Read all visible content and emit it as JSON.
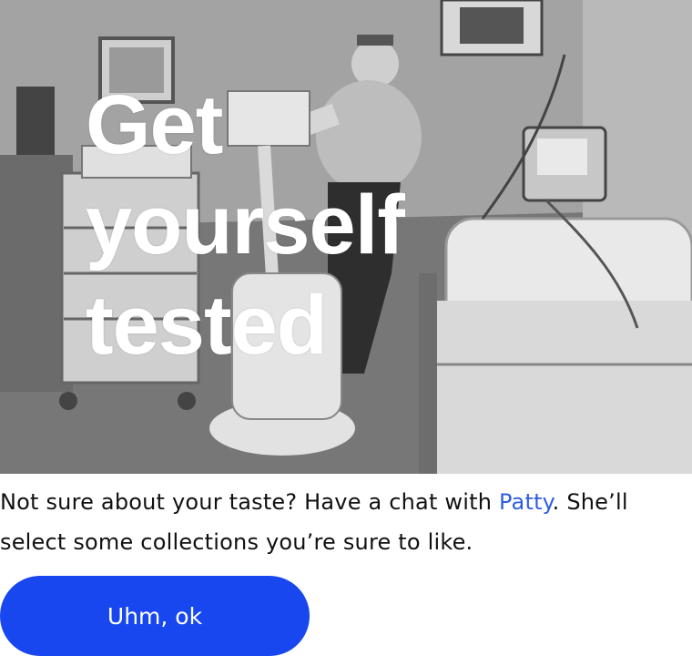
{
  "hero": {
    "title": "Get\nyourself\ntested",
    "image": "black-and-white-photo-exercise-bike-hospital-room"
  },
  "caption": {
    "before": "Not sure about your taste? Have a chat with ",
    "link_text": "Patty",
    "after": ". She’ll select some collections you’re sure to like."
  },
  "cta": {
    "label": "Uhm, ok"
  },
  "colors": {
    "accent": "#1847ef",
    "link": "#2f5de0"
  }
}
